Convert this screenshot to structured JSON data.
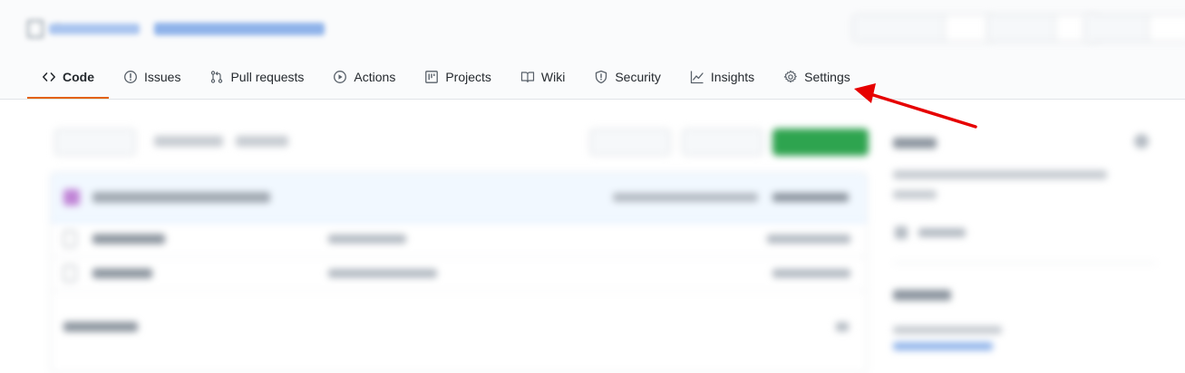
{
  "repo": {
    "owner": "",
    "name": ""
  },
  "repo_actions": {
    "unwatch": "",
    "watch_count": "",
    "star": "",
    "star_count": "",
    "fork": "",
    "fork_count": ""
  },
  "tabs": [
    {
      "label": "Code",
      "icon": "code-icon",
      "selected": true
    },
    {
      "label": "Issues",
      "icon": "issue-opened-icon",
      "selected": false
    },
    {
      "label": "Pull requests",
      "icon": "git-pull-request-icon",
      "selected": false
    },
    {
      "label": "Actions",
      "icon": "play-icon",
      "selected": false
    },
    {
      "label": "Projects",
      "icon": "project-icon",
      "selected": false
    },
    {
      "label": "Wiki",
      "icon": "book-icon",
      "selected": false
    },
    {
      "label": "Security",
      "icon": "shield-icon",
      "selected": false
    },
    {
      "label": "Insights",
      "icon": "graph-icon",
      "selected": false
    },
    {
      "label": "Settings",
      "icon": "gear-icon",
      "selected": false
    }
  ],
  "toolbar": {
    "branch": "",
    "branches": "",
    "tags": "",
    "go_to_file": "",
    "add_file": "",
    "code": ""
  },
  "commit": {
    "author": "",
    "message": "",
    "meta": "",
    "history": ""
  },
  "files": [
    {
      "name": "",
      "commit": "",
      "age": ""
    },
    {
      "name": "",
      "commit": "",
      "age": ""
    }
  ],
  "readme": {
    "title": ""
  },
  "sidebar": {
    "about_heading": "",
    "about_text": "",
    "readme_link": "",
    "releases_heading": "",
    "releases_text": "",
    "releases_link": ""
  },
  "annotation": {
    "arrow_color": "#e60000",
    "points_to": "Settings"
  },
  "colors": {
    "selected_tab_underline": "#e36209",
    "link": "#0366d6",
    "green_button": "#2ea44f",
    "commit_bar": "#f1f8ff"
  }
}
